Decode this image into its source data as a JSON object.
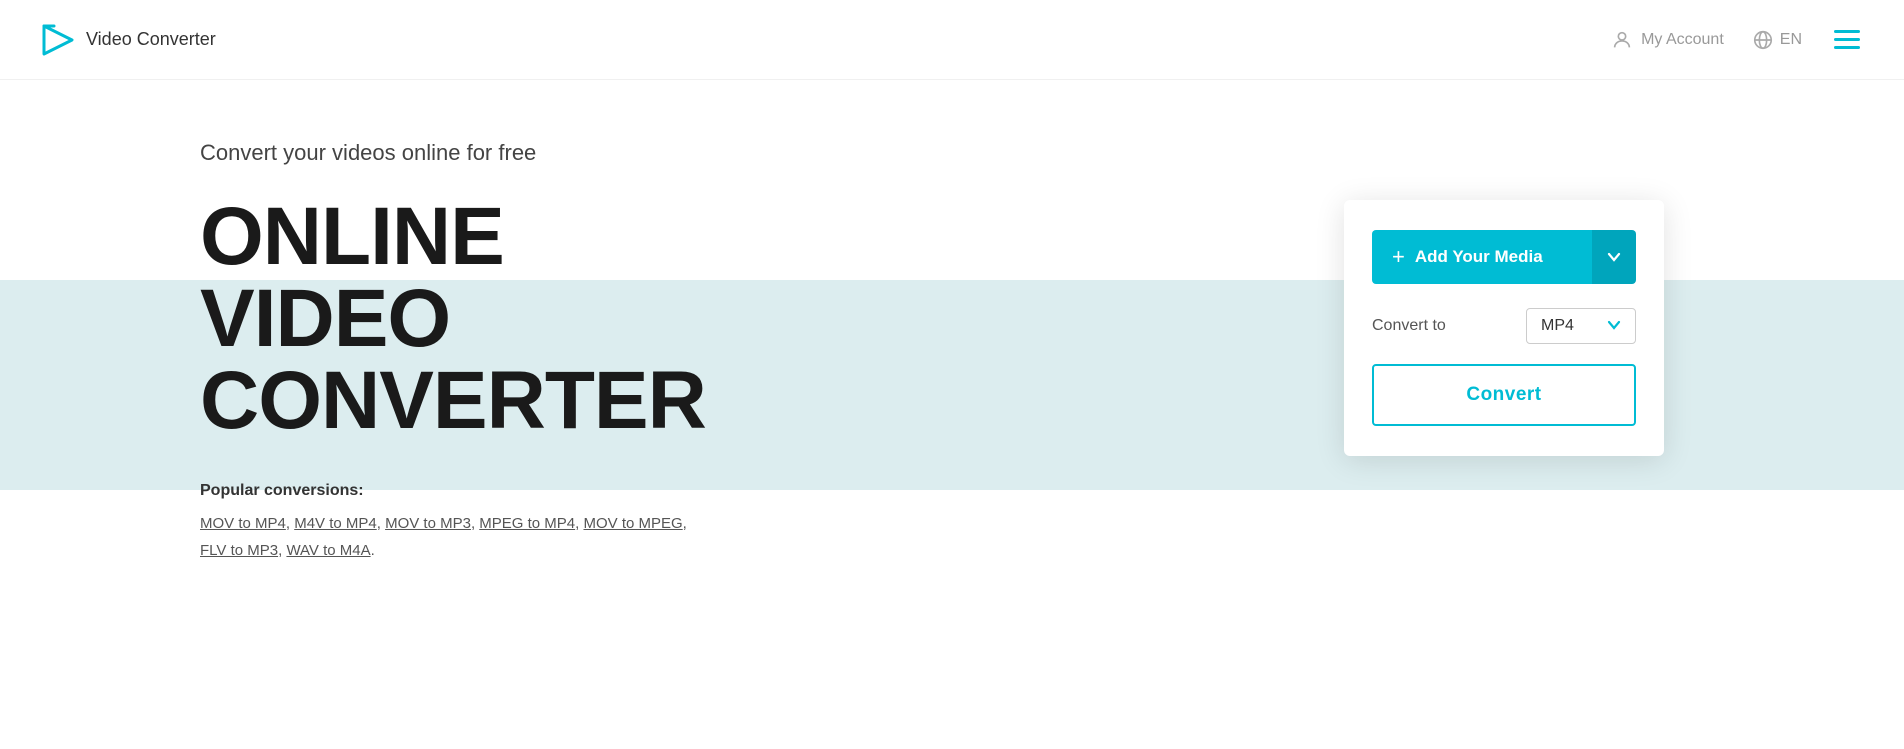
{
  "header": {
    "logo_text": "Video Converter",
    "my_account_label": "My Account",
    "lang_label": "EN",
    "logo_icon_symbol": "▷"
  },
  "hero": {
    "subtitle": "Convert your videos online for free",
    "title_line1": "ONLINE",
    "title_line2": "VIDEO",
    "title_line3": "CONVERTER",
    "popular_label": "Popular conversions:",
    "popular_links": [
      {
        "text": "MOV to MP4",
        "href": "#"
      },
      {
        "text": "M4V to MP4",
        "href": "#"
      },
      {
        "text": "MOV to MP3",
        "href": "#"
      },
      {
        "text": "MPEG to MP4",
        "href": "#"
      },
      {
        "text": "MOV to MPEG",
        "href": "#"
      },
      {
        "text": "FLV to MP3",
        "href": "#"
      },
      {
        "text": "WAV to M4A",
        "href": "#"
      }
    ]
  },
  "converter": {
    "add_media_label": "Add Your Media",
    "convert_to_label": "Convert to",
    "format_value": "MP4",
    "convert_button_label": "Convert"
  }
}
